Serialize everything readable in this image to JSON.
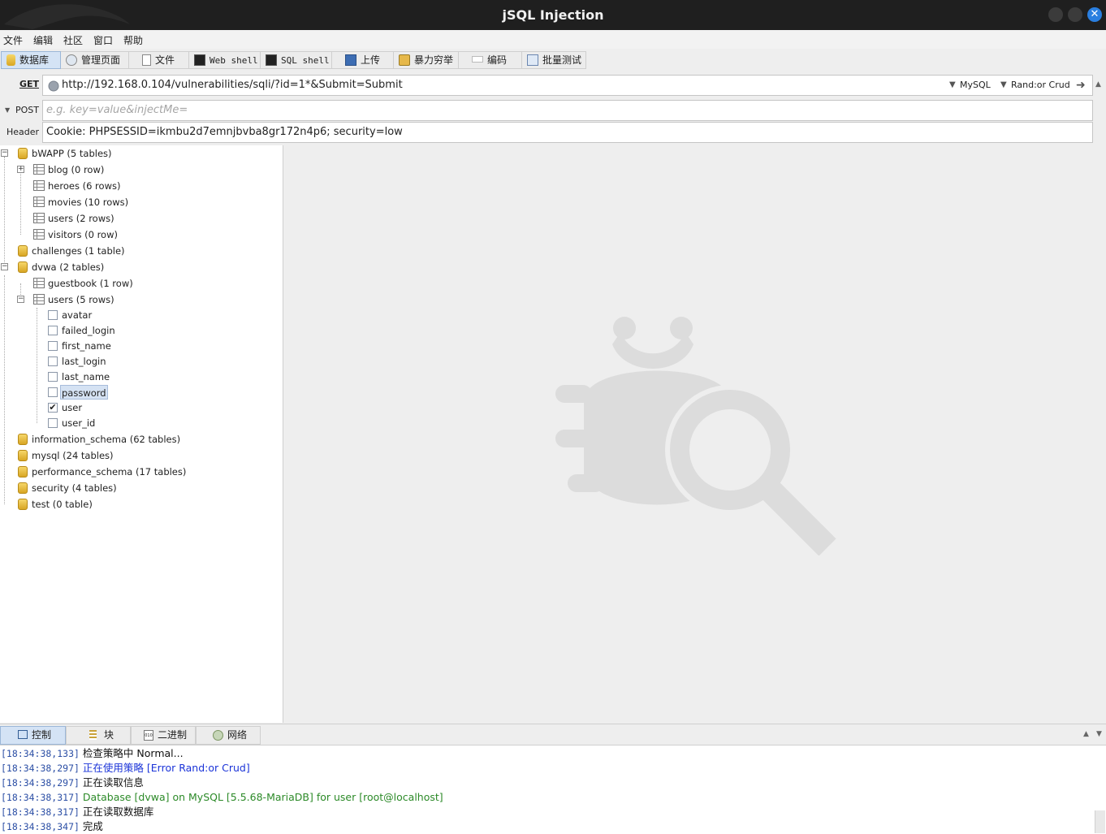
{
  "window": {
    "title": "jSQL Injection"
  },
  "menu": [
    "文件",
    "编辑",
    "社区",
    "窗口",
    "帮助"
  ],
  "toolbar": {
    "tabs": [
      {
        "label": "数据库",
        "icon": "database-icon"
      },
      {
        "label": "管理页面",
        "icon": "admin-page-icon"
      },
      {
        "label": "文件",
        "icon": "file-icon"
      },
      {
        "label": "Web shell",
        "icon": "terminal-icon"
      },
      {
        "label": "SQL shell",
        "icon": "terminal-icon"
      },
      {
        "label": "上传",
        "icon": "upload-icon"
      },
      {
        "label": "暴力穷举",
        "icon": "bruteforce-icon"
      },
      {
        "label": "编码",
        "icon": "encode-icon"
      },
      {
        "label": "批量测试",
        "icon": "batch-test-icon"
      }
    ]
  },
  "request": {
    "method_label": "GET",
    "url": "http://192.168.0.104/vulnerabilities/sqli/?id=1*&Submit=Submit",
    "db_engine": "MySQL",
    "strategy": "Rand:or Crud",
    "post_label": "POST",
    "post_placeholder": "e.g. key=value&injectMe=",
    "header_label": "Header",
    "header_value": "Cookie: PHPSESSID=ikmbu2d7emnjbvba8gr172n4p6; security=low"
  },
  "tree": {
    "bwapp": "bWAPP (5 tables)",
    "blog": "blog (0 row)",
    "heroes": "heroes (6 rows)",
    "movies": "movies (10 rows)",
    "bwapp_users": "users (2 rows)",
    "visitors": "visitors (0 row)",
    "challenges": "challenges (1 table)",
    "dvwa": "dvwa (2 tables)",
    "guestbook": "guestbook (1 row)",
    "dvwa_users": "users (5 rows)",
    "columns": [
      {
        "name": "avatar",
        "checked": false
      },
      {
        "name": "failed_login",
        "checked": false
      },
      {
        "name": "first_name",
        "checked": false
      },
      {
        "name": "last_login",
        "checked": false
      },
      {
        "name": "last_name",
        "checked": false
      },
      {
        "name": "password",
        "checked": false,
        "selected": true
      },
      {
        "name": "user",
        "checked": true
      },
      {
        "name": "user_id",
        "checked": false
      }
    ],
    "information_schema": "information_schema (62 tables)",
    "mysql": "mysql (24 tables)",
    "performance_schema": "performance_schema (17 tables)",
    "security": "security (4 tables)",
    "test": "test (0 table)"
  },
  "bottom_tabs": [
    {
      "label": "控制",
      "icon": "console-icon"
    },
    {
      "label": "块",
      "icon": "chunk-icon"
    },
    {
      "label": "二进制",
      "icon": "binary-icon"
    },
    {
      "label": "网络",
      "icon": "network-icon"
    }
  ],
  "console": [
    {
      "ts": "[18:34:38,133]",
      "msg": "检查策略中 Normal...",
      "color": "default"
    },
    {
      "ts": "[18:34:38,297]",
      "msg": "正在使用策略 [Error Rand:or Crud]",
      "color": "blue"
    },
    {
      "ts": "[18:34:38,297]",
      "msg": "正在读取信息",
      "color": "default"
    },
    {
      "ts": "[18:34:38,317]",
      "msg": "Database [dvwa] on MySQL [5.5.68-MariaDB] for user [root@localhost]",
      "color": "green"
    },
    {
      "ts": "[18:34:38,317]",
      "msg": "正在读取数据库",
      "color": "default"
    },
    {
      "ts": "[18:34:38,347]",
      "msg": "完成",
      "color": "default"
    }
  ],
  "colors": {
    "title_bg": "#1f1f1f",
    "active_tab": "#d4e3f5",
    "log_blue": "#1a33d8",
    "log_green": "#2c8a28",
    "timestamp": "#2c4fa5"
  }
}
